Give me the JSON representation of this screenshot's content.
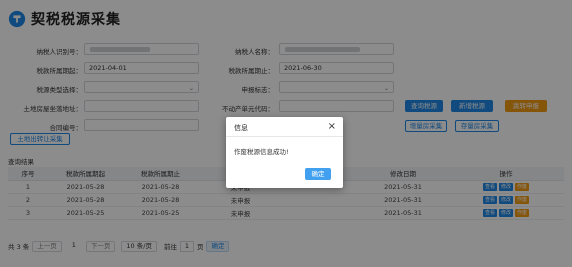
{
  "title": "契税税源采集",
  "colors": {
    "primary": "#1e88e5",
    "orange": "#f39c12"
  },
  "form": {
    "taxpayer_id_label": "纳税人识别号：",
    "taxpayer_name_label": "纳税人名称：",
    "period_start_label": "税款所属期起：",
    "period_start_value": "2021-04-01",
    "period_end_label": "税款所属期止：",
    "period_end_value": "2021-06-30",
    "source_type_label": "税源类型选择：",
    "report_flag_label": "申报标志：",
    "land_address_label": "土地房屋坐落地址：",
    "property_code_label": "不动产单元代码：",
    "contract_no_label": "合同编号："
  },
  "buttons": {
    "query": "查询税源",
    "add": "新增税源",
    "jump_declare": "跳转申报",
    "land_transfer": "土地出转让采集",
    "stock_house": "增量房采集",
    "stock_house2": "存量房采集"
  },
  "results": {
    "title": "查询结果",
    "columns": [
      "序号",
      "税款所属期起",
      "税款所属期止",
      "申报标志",
      "",
      "修改日期",
      "操作"
    ],
    "rows": [
      {
        "no": "1",
        "start": "2021-05-28",
        "end": "2021-05-28",
        "flag": "未申报",
        "extra": "",
        "modified": "2021-05-31"
      },
      {
        "no": "2",
        "start": "2021-05-28",
        "end": "2021-05-28",
        "flag": "未申报",
        "extra": "",
        "modified": "2021-05-31"
      },
      {
        "no": "3",
        "start": "2021-05-25",
        "end": "2021-05-25",
        "flag": "未申报",
        "extra": "",
        "modified": "2021-05-31"
      }
    ],
    "ops": {
      "view": "查看",
      "edit": "修改",
      "void": "作废"
    }
  },
  "pager": {
    "total": "共 3 条",
    "prev": "上一页",
    "page": "1",
    "next": "下一页",
    "page_size": "10 条/页",
    "goto_label": "前往",
    "goto_value": "1",
    "page_unit": "页",
    "confirm": "确定"
  },
  "modal": {
    "title": "信息",
    "close": "×",
    "message": "作废税源信息成功!",
    "ok": "确定"
  }
}
